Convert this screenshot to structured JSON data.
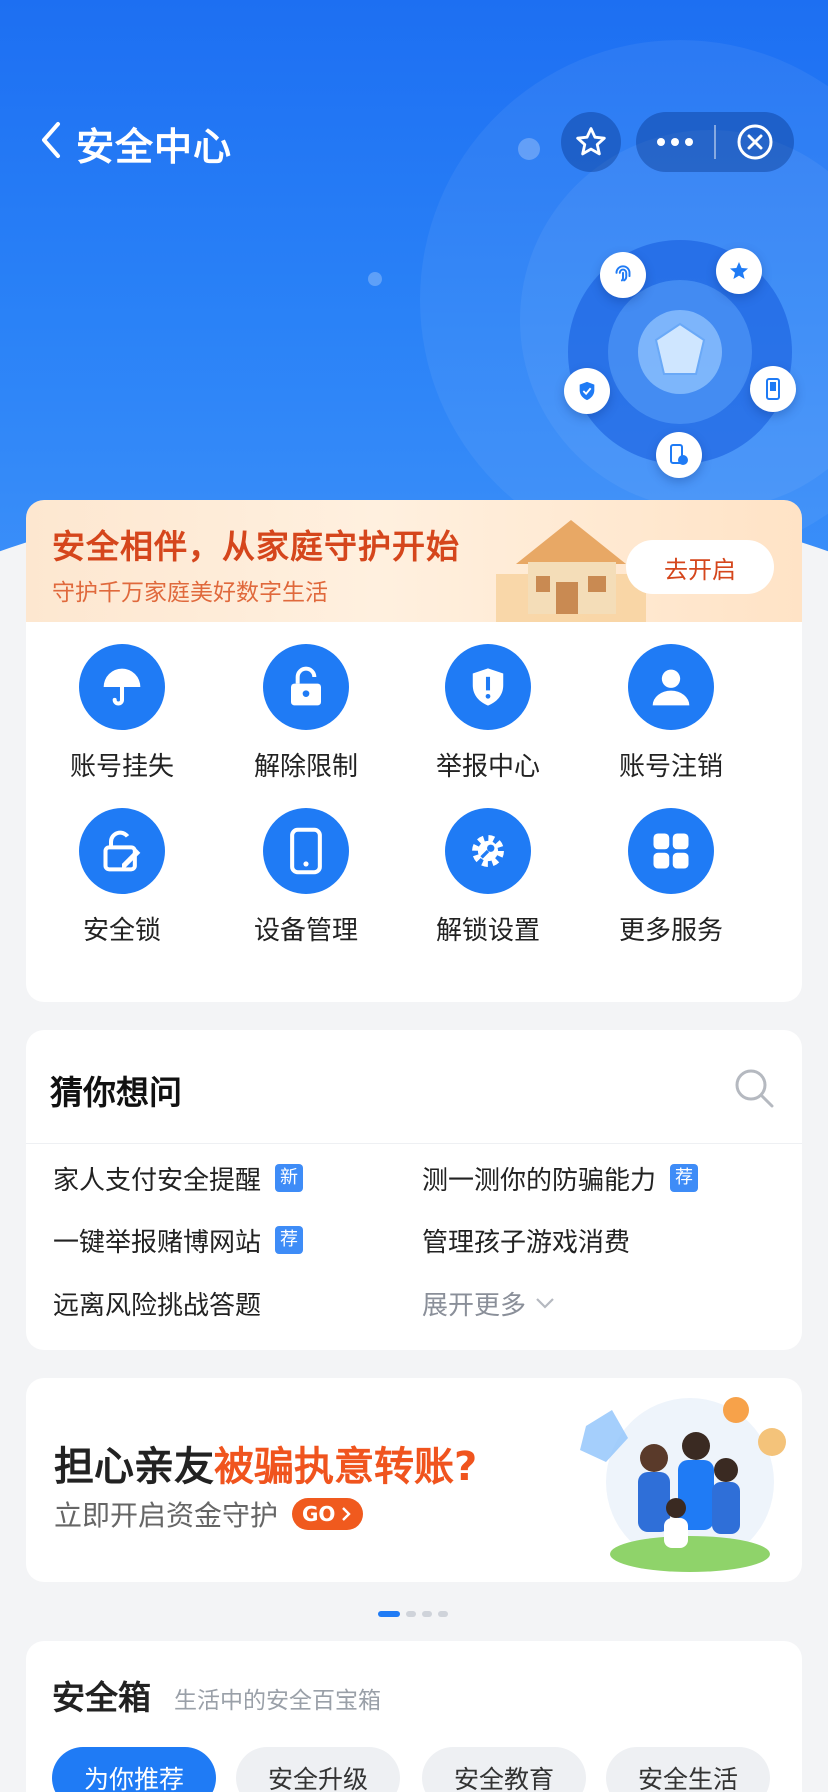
{
  "nav": {
    "title": "安全中心"
  },
  "banner": {
    "title": "安全相伴，从家庭守护开始",
    "subtitle": "守护千万家庭美好数字生活",
    "button": "去开启"
  },
  "services": [
    {
      "label": "账号挂失",
      "icon": "umbrella-icon"
    },
    {
      "label": "解除限制",
      "icon": "unlock-icon"
    },
    {
      "label": "举报中心",
      "icon": "shield-alert-icon"
    },
    {
      "label": "账号注销",
      "icon": "user-icon"
    },
    {
      "label": "安全锁",
      "icon": "lock-edit-icon"
    },
    {
      "label": "设备管理",
      "icon": "phone-icon"
    },
    {
      "label": "解锁设置",
      "icon": "gear-key-icon"
    },
    {
      "label": "更多服务",
      "icon": "grid-icon"
    }
  ],
  "guess": {
    "title": "猜你想问",
    "items": [
      {
        "text": "家人支付安全提醒",
        "tag": "新"
      },
      {
        "text": "测一测你的防骗能力",
        "tag": "荐"
      },
      {
        "text": "一键举报赌博网站",
        "tag": "荐"
      },
      {
        "text": "管理孩子游戏消费",
        "tag": ""
      },
      {
        "text": "远离风险挑战答题",
        "tag": ""
      }
    ],
    "expand": "展开更多"
  },
  "promo": {
    "title_prefix": "担心亲友",
    "title_highlight": "被骗执意转账?",
    "subtitle": "立即开启资金守护",
    "go": "GO"
  },
  "safe_box": {
    "title": "安全箱",
    "subtitle": "生活中的安全百宝箱",
    "chips": [
      "为你推荐",
      "安全升级",
      "安全教育",
      "安全生活"
    ]
  },
  "colors": {
    "brand_blue": "#1f7bf5",
    "accent_orange": "#f0541e",
    "banner_red": "#d5461c"
  }
}
